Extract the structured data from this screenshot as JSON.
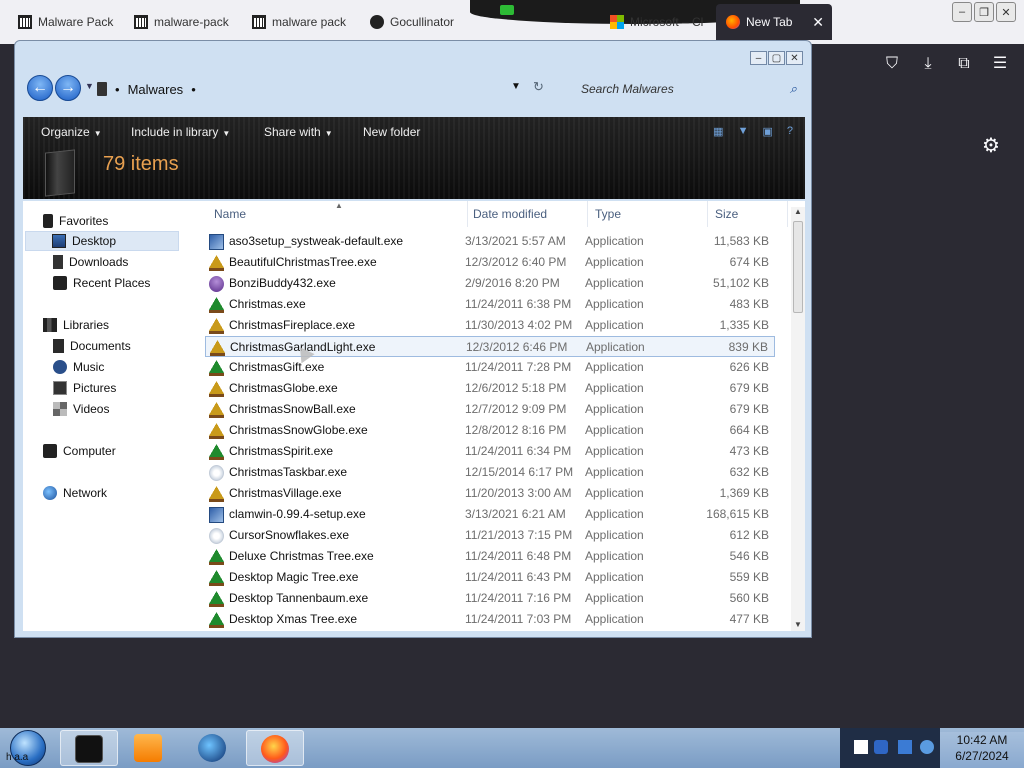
{
  "browser": {
    "tabs": [
      {
        "label": "Malware Pack",
        "icon": "archive-icon"
      },
      {
        "label": "malware-pack",
        "icon": "archive-icon"
      },
      {
        "label": "malware pack",
        "icon": "archive-icon"
      },
      {
        "label": "Gocullinator",
        "icon": "github-icon"
      },
      {
        "label": "Microsoft – Cl",
        "icon": "microsoft-icon"
      },
      {
        "label": "New Tab",
        "icon": "firefox-icon"
      }
    ],
    "close_tab": "✕",
    "window_buttons": [
      "–",
      "❐",
      "✕"
    ]
  },
  "explorer": {
    "path_label": "Malwares",
    "search_placeholder": "Search Malwares",
    "commands": {
      "organize": "Organize",
      "include_in_library": "Include in library",
      "share_with": "Share with",
      "new_folder": "New folder"
    },
    "item_count": "79 items",
    "nav": {
      "favorites": "Favorites",
      "desktop": "Desktop",
      "downloads": "Downloads",
      "recent_places": "Recent Places",
      "libraries": "Libraries",
      "documents": "Documents",
      "music": "Music",
      "pictures": "Pictures",
      "videos": "Videos",
      "computer": "Computer",
      "network": "Network"
    },
    "columns": {
      "name": "Name",
      "date": "Date modified",
      "type": "Type",
      "size": "Size"
    },
    "files": [
      {
        "name": "aso3setup_systweak-default.exe",
        "date": "3/13/2021 5:57 AM",
        "type": "Application",
        "size": "11,583 KB",
        "icon": "setup-icon"
      },
      {
        "name": "BeautifulChristmasTree.exe",
        "date": "12/3/2012 6:40 PM",
        "type": "Application",
        "size": "674 KB",
        "icon": "gold-tree-icon"
      },
      {
        "name": "BonziBuddy432.exe",
        "date": "2/9/2016 8:20 PM",
        "type": "Application",
        "size": "51,102 KB",
        "icon": "bonzi-icon"
      },
      {
        "name": "Christmas.exe",
        "date": "11/24/2011 6:38 PM",
        "type": "Application",
        "size": "483 KB",
        "icon": "tree-icon"
      },
      {
        "name": "ChristmasFireplace.exe",
        "date": "11/30/2013 4:02 PM",
        "type": "Application",
        "size": "1,335 KB",
        "icon": "gold-tree-icon"
      },
      {
        "name": "ChristmasGarlandLight.exe",
        "date": "12/3/2012 6:46 PM",
        "type": "Application",
        "size": "839 KB",
        "icon": "gold-tree-icon"
      },
      {
        "name": "ChristmasGift.exe",
        "date": "11/24/2011 7:28 PM",
        "type": "Application",
        "size": "626 KB",
        "icon": "tree-icon"
      },
      {
        "name": "ChristmasGlobe.exe",
        "date": "12/6/2012 5:18 PM",
        "type": "Application",
        "size": "679 KB",
        "icon": "gold-tree-icon"
      },
      {
        "name": "ChristmasSnowBall.exe",
        "date": "12/7/2012 9:09 PM",
        "type": "Application",
        "size": "679 KB",
        "icon": "gold-tree-icon"
      },
      {
        "name": "ChristmasSnowGlobe.exe",
        "date": "12/8/2012 8:16 PM",
        "type": "Application",
        "size": "664 KB",
        "icon": "gold-tree-icon"
      },
      {
        "name": "ChristmasSpirit.exe",
        "date": "11/24/2011 6:34 PM",
        "type": "Application",
        "size": "473 KB",
        "icon": "tree-icon"
      },
      {
        "name": "ChristmasTaskbar.exe",
        "date": "12/15/2014 6:17 PM",
        "type": "Application",
        "size": "632 KB",
        "icon": "snowflake-icon"
      },
      {
        "name": "ChristmasVillage.exe",
        "date": "11/20/2013 3:00 AM",
        "type": "Application",
        "size": "1,369 KB",
        "icon": "gold-tree-icon"
      },
      {
        "name": "clamwin-0.99.4-setup.exe",
        "date": "3/13/2021 6:21 AM",
        "type": "Application",
        "size": "168,615 KB",
        "icon": "setup-icon"
      },
      {
        "name": "CursorSnowflakes.exe",
        "date": "11/21/2013 7:15 PM",
        "type": "Application",
        "size": "612 KB",
        "icon": "snowflake-icon"
      },
      {
        "name": "Deluxe Christmas Tree.exe",
        "date": "11/24/2011 6:48 PM",
        "type": "Application",
        "size": "546 KB",
        "icon": "tree-icon"
      },
      {
        "name": "Desktop Magic Tree.exe",
        "date": "11/24/2011 6:43 PM",
        "type": "Application",
        "size": "559 KB",
        "icon": "tree-icon"
      },
      {
        "name": "Desktop Tannenbaum.exe",
        "date": "11/24/2011 7:16 PM",
        "type": "Application",
        "size": "560 KB",
        "icon": "tree-icon"
      },
      {
        "name": "Desktop Xmas Tree.exe",
        "date": "11/24/2011 7:03 PM",
        "type": "Application",
        "size": "477 KB",
        "icon": "tree-icon"
      }
    ]
  },
  "taskbar": {
    "start_label": "h a.a",
    "time": "10:42 AM",
    "date": "6/27/2024"
  }
}
